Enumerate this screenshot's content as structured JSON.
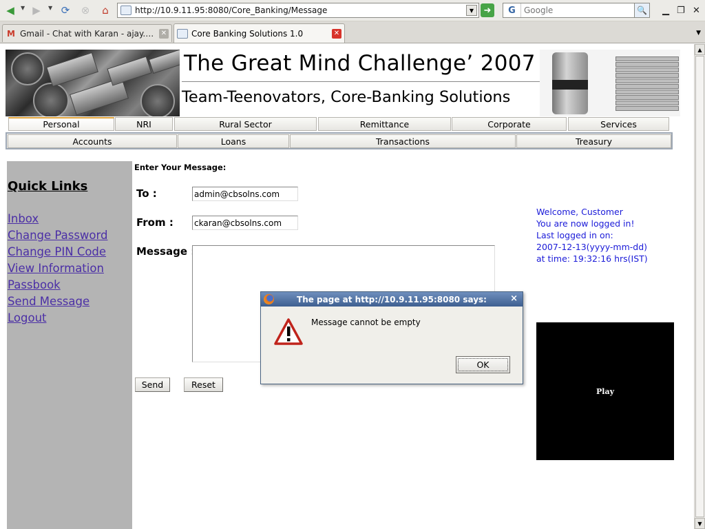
{
  "browser": {
    "url": "http://10.9.11.95:8080/Core_Banking/Message",
    "search_placeholder": "Google",
    "tabs": [
      {
        "label": "Gmail - Chat with Karan - ajay.kr..."
      },
      {
        "label": "Core Banking Solutions 1.0"
      }
    ]
  },
  "banner": {
    "title": "The Great Mind Challenge’ 2007",
    "subtitle": "Team-Teenovators, Core-Banking Solutions"
  },
  "nav_primary": [
    "Personal",
    "NRI",
    "Rural Sector",
    "Remittance",
    "Corporate",
    "Services"
  ],
  "nav_secondary": [
    "Accounts",
    "Loans",
    "Transactions",
    "Treasury"
  ],
  "quick_links": {
    "title": "Quick Links",
    "items": [
      "Inbox",
      "Change Password",
      "Change PIN Code",
      "View Information",
      "Passbook",
      "Send Message",
      "Logout"
    ]
  },
  "form": {
    "heading": "Enter Your Message:",
    "to_label": "To :",
    "to_value": "admin@cbsolns.com",
    "from_label": "From :",
    "from_value": "ckaran@cbsolns.com",
    "message_label": "Message :",
    "send_label": "Send",
    "reset_label": "Reset"
  },
  "welcome": {
    "line1": "Welcome, Customer",
    "line2": "You are now logged in!",
    "line3": "Last logged in on:",
    "line4": "2007-12-13(yyyy-mm-dd)",
    "line5": "at time: 19:32:16 hrs(IST)"
  },
  "player": {
    "label": "Play"
  },
  "dialog": {
    "title": "The page at http://10.9.11.95:8080 says:",
    "message": "Message cannot be empty",
    "ok_label": "OK",
    "close_glyph": "×"
  },
  "colors": {
    "sidebar_bg": "#b4b4b4",
    "link": "#4b2fa6",
    "welcome_text": "#1a1ad8",
    "dialog_title": "#4f6fa0"
  }
}
